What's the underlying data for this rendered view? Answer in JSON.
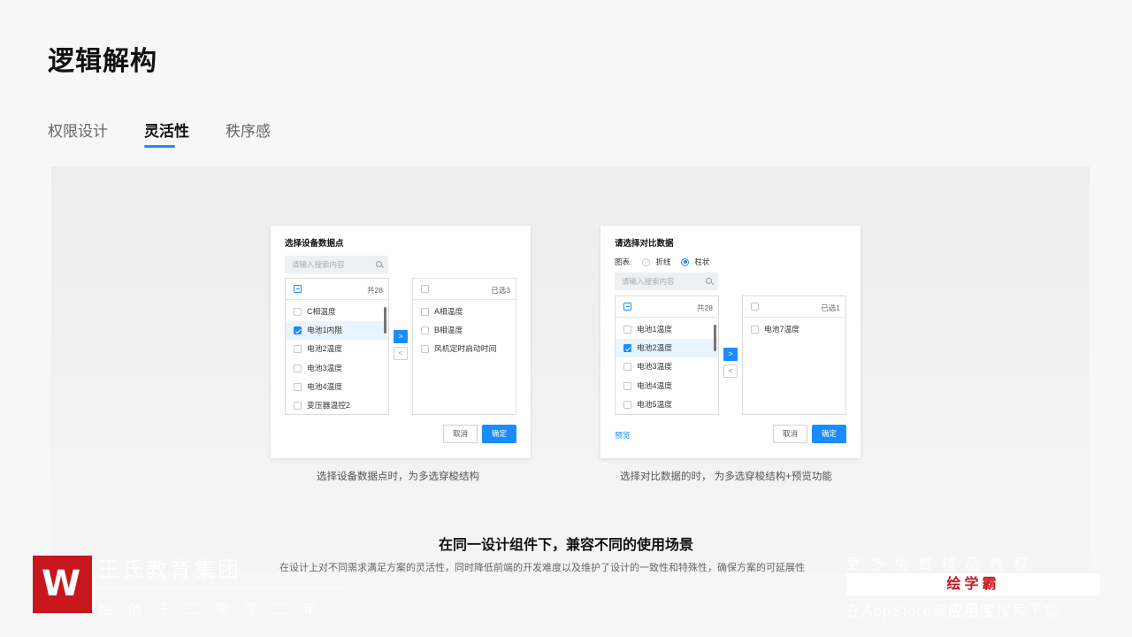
{
  "page_title": "逻辑解构",
  "tabs": [
    {
      "label": "权限设计",
      "active": false
    },
    {
      "label": "灵活性",
      "active": true
    },
    {
      "label": "秩序感",
      "active": false
    }
  ],
  "dialog_left": {
    "title": "选择设备数据点",
    "search_placeholder": "请输入搜索内容",
    "source_count": "共28",
    "source_items": [
      "C相温度",
      "电池1内阻",
      "电池2温度",
      "电池3温度",
      "电池4温度",
      "变压器温控2"
    ],
    "selected_index": 1,
    "target_count": "已选3",
    "target_items": [
      "A相温度",
      "B相温度",
      "风机定时启动时间"
    ],
    "cancel": "取消",
    "ok": "确定",
    "caption": "选择设备数据点时，为多选穿梭结构"
  },
  "dialog_right": {
    "title": "请选择对比数据",
    "chart_label": "图表:",
    "radio_line": "折线",
    "radio_bar": "柱状",
    "radio_selected": "柱状",
    "search_placeholder": "请输入搜索内容",
    "source_count": "共28",
    "source_items": [
      "电池1温度",
      "电池2温度",
      "电池3温度",
      "电池4温度",
      "电池5温度"
    ],
    "selected_index": 1,
    "target_count": "已选1",
    "target_items": [
      "电池7温度"
    ],
    "preview": "预览",
    "cancel": "取消",
    "ok": "确定",
    "caption": "选择对比数据的时，  为多选穿梭结构+预览功能"
  },
  "headline": "在同一设计组件下，兼容不同的使用场景",
  "subline": "在设计上对不同需求满足方案的灵活性，同时降低前端的开发难度以及维护了设计的一致性和特殊性，确保方案的可延展性",
  "watermark": {
    "brand": "王氏教育集团",
    "brand_sub": "始创于二零零二年",
    "promo_top": "更多免费精品教程",
    "promo_app": "绘学霸",
    "promo_bottom_pre": "在AppStore或",
    "promo_bottom_bold": "应用宝",
    "promo_bottom_post": "搜索下载"
  },
  "colors": {
    "accent": "#1a8cff",
    "brand_red": "#c8161d"
  }
}
